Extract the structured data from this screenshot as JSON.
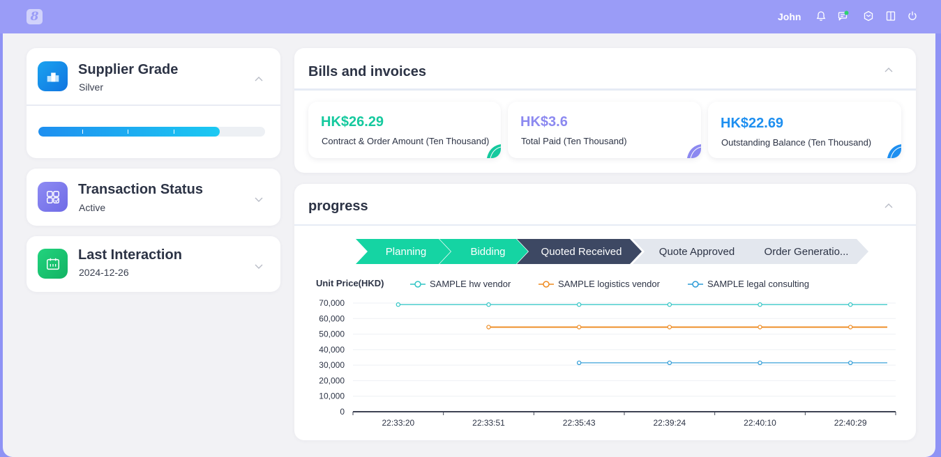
{
  "header": {
    "logo": "8",
    "user": "John",
    "icons": [
      "bell-icon",
      "message-icon",
      "cube-icon",
      "book-icon",
      "power-icon"
    ],
    "notification_color": "#2dd36f"
  },
  "left": {
    "supplier_grade": {
      "title": "Supplier Grade",
      "value": "Silver",
      "progress_percent": 80
    },
    "transaction_status": {
      "title": "Transaction Status",
      "value": "Active"
    },
    "last_interaction": {
      "title": "Last Interaction",
      "value": "2024-12-26"
    }
  },
  "bills": {
    "title": "Bills and invoices",
    "cards": [
      {
        "amount": "HK$26.29",
        "label": "Contract & Order Amount (Ten Thousand)",
        "color": "#15c99e"
      },
      {
        "amount": "HK$3.6",
        "label": "Total Paid (Ten Thousand)",
        "color": "#8c89f0"
      },
      {
        "amount": "HK$22.69",
        "label": "Outstanding Balance (Ten Thousand)",
        "color": "#1e8ff0"
      }
    ]
  },
  "progress": {
    "title": "progress",
    "steps": [
      {
        "label": "Planning",
        "state": "done"
      },
      {
        "label": "Bidding",
        "state": "done"
      },
      {
        "label": "Quoted Received",
        "state": "current"
      },
      {
        "label": "Quote Approved",
        "state": "pending"
      },
      {
        "label": "Order Generatio...",
        "state": "pending"
      }
    ]
  },
  "chart_data": {
    "type": "line",
    "ylabel": "Unit Price(HKD)",
    "ylim": [
      0,
      70000
    ],
    "yticks": [
      "70,000",
      "60,000",
      "50,000",
      "40,000",
      "30,000",
      "20,000",
      "10,000",
      "0"
    ],
    "categories": [
      "22:33:20",
      "22:33:51",
      "22:35:43",
      "22:39:24",
      "22:40:10",
      "22:40:29"
    ],
    "series": [
      {
        "name": "SAMPLE hw vendor",
        "color": "#2ec4c4",
        "values": [
          69000,
          69000,
          69000,
          69000,
          69000,
          69000
        ]
      },
      {
        "name": "SAMPLE logistics vendor",
        "color": "#ee8a1f",
        "values": [
          null,
          54500,
          54500,
          54500,
          54500,
          54500
        ]
      },
      {
        "name": "SAMPLE legal consulting",
        "color": "#2a9ad6",
        "values": [
          null,
          null,
          31500,
          31500,
          31500,
          31500
        ]
      }
    ],
    "grid": true,
    "legend_position": "top"
  }
}
